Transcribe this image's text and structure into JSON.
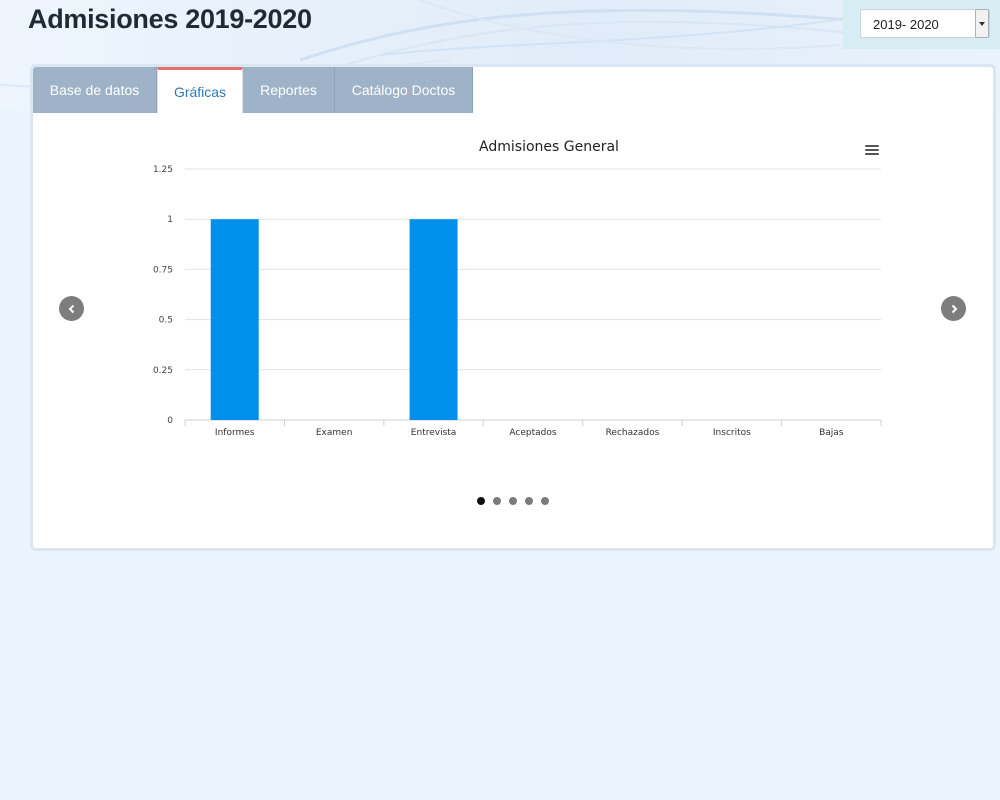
{
  "header": {
    "title": "Admisiones 2019-2020",
    "year_select": {
      "value": "2019- 2020"
    }
  },
  "tabs": [
    {
      "label": "Base de datos",
      "active": false
    },
    {
      "label": "Gráficas",
      "active": true
    },
    {
      "label": "Reportes",
      "active": false
    },
    {
      "label": "Catálogo Doctos",
      "active": false
    }
  ],
  "chart_data": {
    "type": "bar",
    "title": "Admisiones General",
    "categories": [
      "Informes",
      "Examen",
      "Entrevista",
      "Aceptados",
      "Rechazados",
      "Inscritos",
      "Bajas"
    ],
    "values": [
      1,
      0,
      1,
      0,
      0,
      0,
      0
    ],
    "ylim": [
      0,
      1.25
    ],
    "yticks": [
      "0",
      "0.25",
      "0.5",
      "0.75",
      "1",
      "1.25"
    ],
    "grid": true,
    "bar_color": "#0090ec"
  },
  "carousel": {
    "slide_count": 5,
    "active_index": 0
  },
  "icons": {
    "prev": "chevron-left-icon",
    "next": "chevron-right-icon",
    "menu": "hamburger-menu-icon",
    "dropdown": "caret-down-icon"
  }
}
